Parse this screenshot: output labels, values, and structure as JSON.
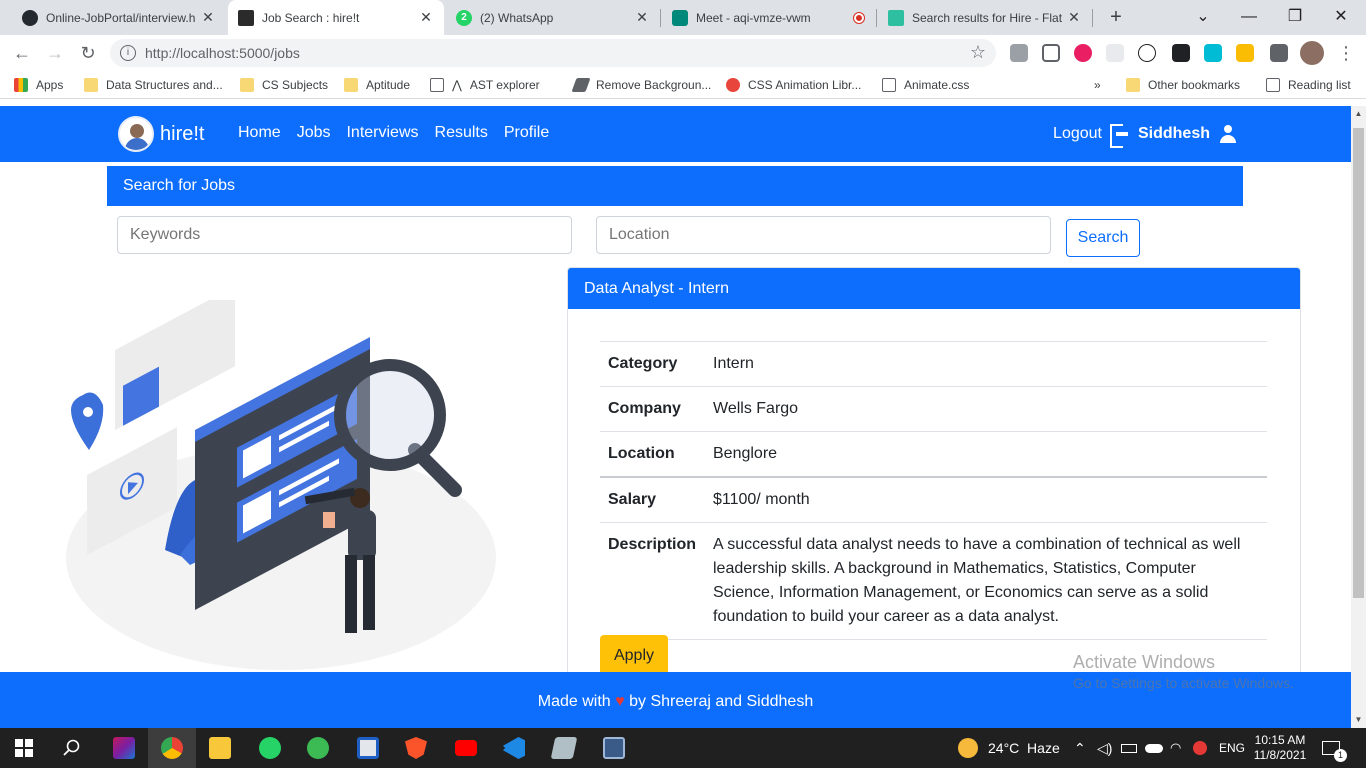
{
  "browser": {
    "tabs": [
      {
        "title": "Online-JobPortal/interview.h",
        "favicon": "github-icon",
        "color": "#24292f"
      },
      {
        "title": "Job Search : hire!t",
        "favicon": "terminal-icon",
        "color": "#2b2b2b"
      },
      {
        "title": "(2) WhatsApp",
        "favicon": "whatsapp-icon",
        "color": "#25d366"
      },
      {
        "title": "Meet - aqi-vmze-vwm",
        "favicon": "meet-icon",
        "color": "#00897b"
      },
      {
        "title": "Search results for Hire - Flat",
        "favicon": "flaticon-icon",
        "color": "#2dbfa0"
      }
    ],
    "whatsapp_badge": "2",
    "url": "http://localhost:5000/jobs",
    "bookmarks": [
      {
        "label": "Apps",
        "icon": "apps-grid-icon"
      },
      {
        "label": "Data Structures and...",
        "icon": "folder-icon"
      },
      {
        "label": "CS Subjects",
        "icon": "folder-icon"
      },
      {
        "label": "Aptitude",
        "icon": "folder-icon"
      },
      {
        "label": "AST explorer",
        "icon": "ast-icon"
      },
      {
        "label": "Remove Backgroun...",
        "icon": "remove-bg-icon"
      },
      {
        "label": "CSS Animation Libr...",
        "icon": "css-anim-icon"
      },
      {
        "label": "Animate.css",
        "icon": "globe-icon"
      }
    ],
    "overflow": "»",
    "other_bookmarks": "Other bookmarks",
    "reading_list": "Reading list"
  },
  "app": {
    "brand": "hire!t",
    "nav": [
      "Home",
      "Jobs",
      "Interviews",
      "Results",
      "Profile"
    ],
    "logout": "Logout",
    "username": "Siddhesh",
    "search_header": "Search for Jobs",
    "keywords_placeholder": "Keywords",
    "location_placeholder": "Location",
    "search_button": "Search",
    "job": {
      "title": "Data Analyst - Intern",
      "rows": [
        {
          "key": "Category",
          "value": "Intern"
        },
        {
          "key": "Company",
          "value": "Wells Fargo"
        },
        {
          "key": "Location",
          "value": "Benglore"
        },
        {
          "key": "Salary",
          "value": "$1100/ month"
        },
        {
          "key": "Description",
          "value": "A successful data analyst needs to have a combination of technical as well leadership skills. A background in Mathematics, Statistics, Computer Science, Information Management, or Economics can serve as a solid foundation to build your career as a data analyst."
        }
      ],
      "apply_button": "Apply"
    },
    "footer_before": "Made with",
    "footer_heart": "♥",
    "footer_after": "by Shreeraj and Siddhesh"
  },
  "watermark": {
    "line1": "Activate Windows",
    "line2": "Go to Settings to activate Windows."
  },
  "taskbar": {
    "weather": "24°C  Haze",
    "language": "ENG",
    "time": "10:15 AM",
    "date": "11/8/2021",
    "notification_count": "1"
  },
  "colors": {
    "primary": "#0d6efd",
    "apply": "#ffc107"
  }
}
